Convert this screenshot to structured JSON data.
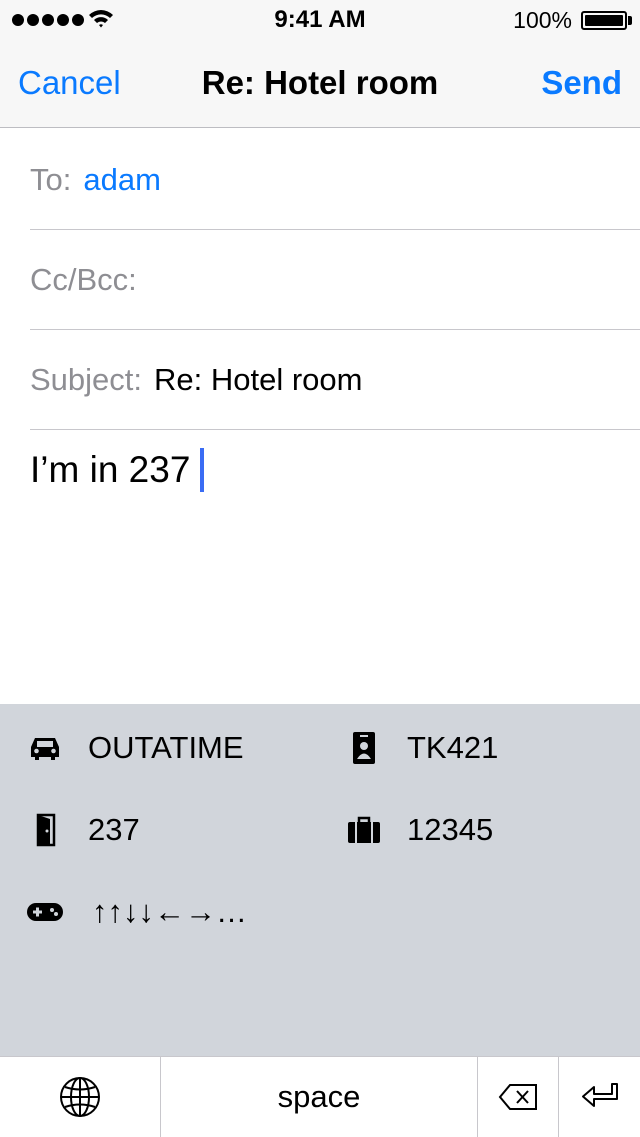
{
  "status_bar": {
    "time": "9:41 AM",
    "battery_percent": "100%",
    "signal_icon": "signal-dots-icon",
    "wifi_icon": "wifi-icon",
    "battery_icon": "battery-icon"
  },
  "nav": {
    "cancel_label": "Cancel",
    "title": "Re: Hotel room",
    "send_label": "Send"
  },
  "compose": {
    "to_label": "To:",
    "to_value": "adam",
    "ccbcc_label": "Cc/Bcc:",
    "subject_label": "Subject:",
    "subject_value": "Re: Hotel room",
    "body": "I’m in 237"
  },
  "suggestions": [
    {
      "icon": "car-icon",
      "label": "OUTATIME"
    },
    {
      "icon": "id-badge-icon",
      "label": "TK421"
    },
    {
      "icon": "door-icon",
      "label": "237"
    },
    {
      "icon": "suitcase-icon",
      "label": "12345"
    },
    {
      "icon": "gamepad-icon",
      "label": "↑↑↓↓←→…"
    }
  ],
  "bottom_bar": {
    "globe_icon": "globe-icon",
    "space_label": "space",
    "delete_icon": "backspace-icon",
    "return_icon": "return-icon"
  },
  "colors": {
    "accent": "#0a7aff",
    "cursor": "#3a6cf4",
    "keyboard_bg": "#d1d5db"
  }
}
